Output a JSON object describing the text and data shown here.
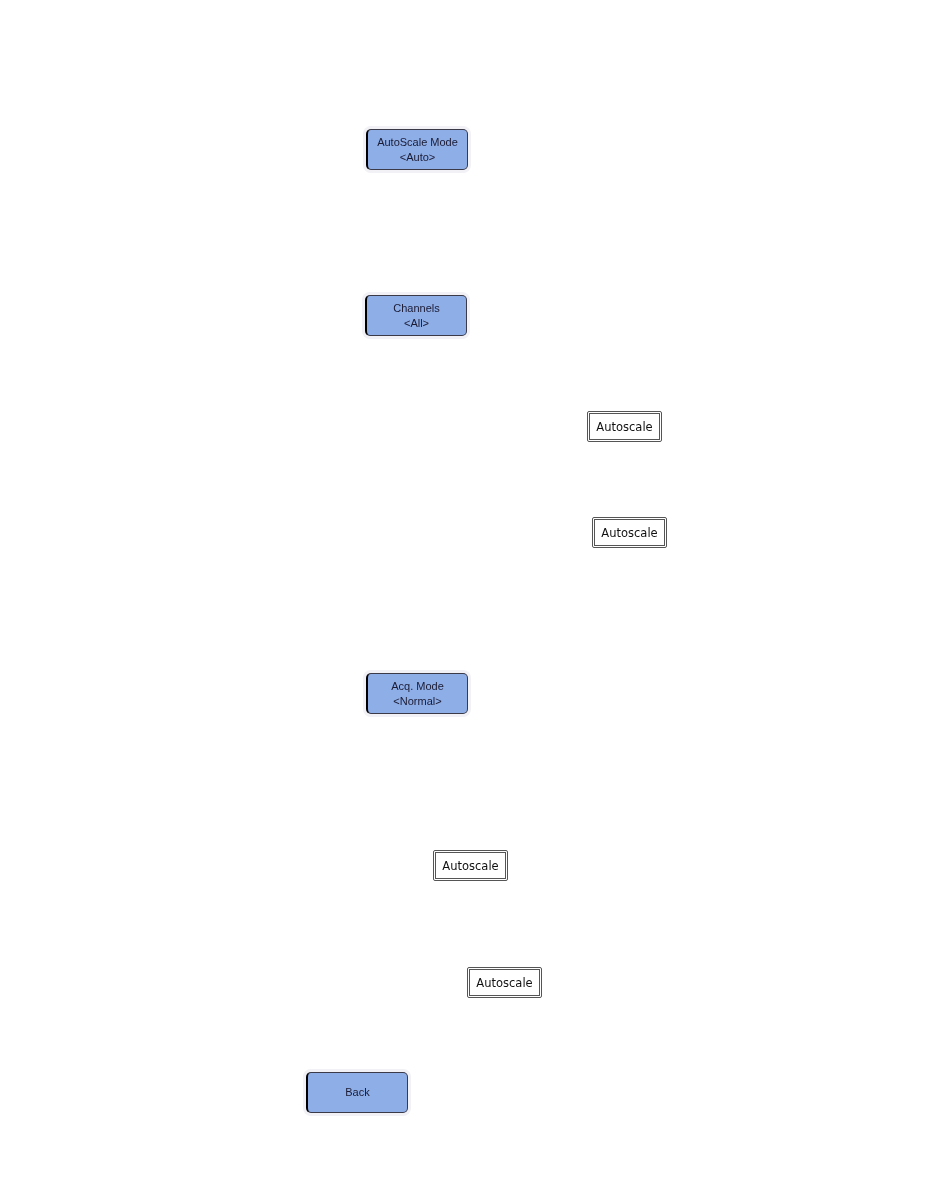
{
  "items": [
    {
      "kind": "softkey",
      "label": "AutoScale Mode",
      "value": "<Auto>"
    },
    {
      "kind": "softkey",
      "label": "Channels",
      "value": "<All>"
    },
    {
      "kind": "key",
      "label": "Autoscale"
    },
    {
      "kind": "key",
      "label": "Autoscale"
    },
    {
      "kind": "softkey",
      "label": "Acq. Mode",
      "value": "<Normal>"
    },
    {
      "kind": "key",
      "label": "Autoscale"
    },
    {
      "kind": "key",
      "label": "Autoscale"
    },
    {
      "kind": "softkey",
      "label": "Back"
    }
  ]
}
